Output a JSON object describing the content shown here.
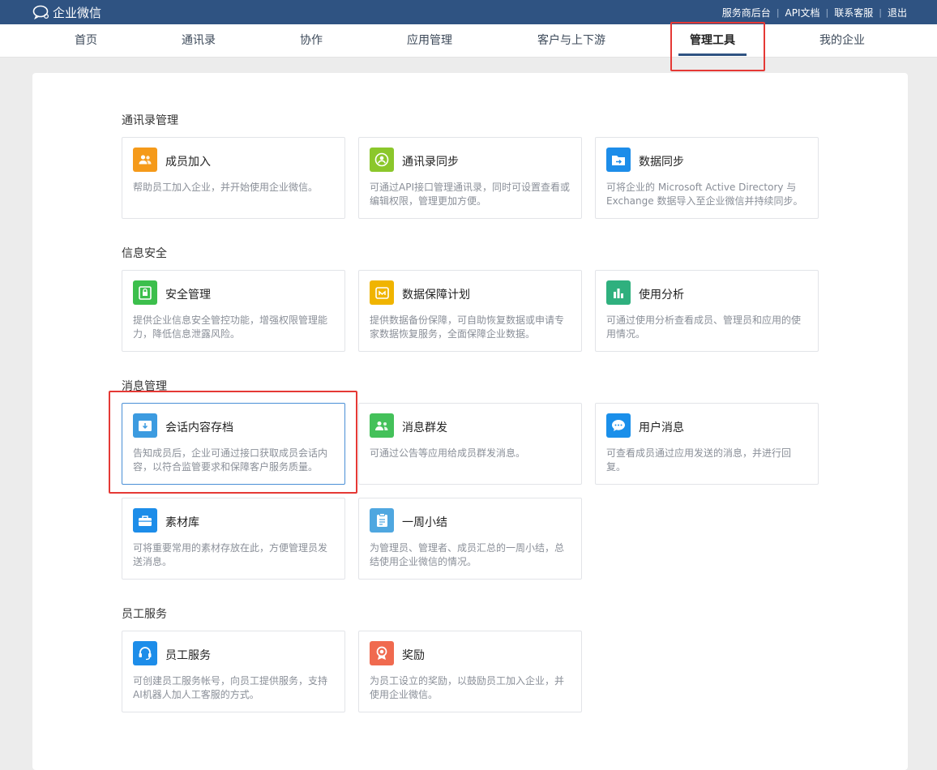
{
  "brand": {
    "name": "企业微信"
  },
  "toplinks": [
    "服务商后台",
    "API文档",
    "联系客服",
    "退出"
  ],
  "nav": {
    "items": [
      "首页",
      "通讯录",
      "协作",
      "应用管理",
      "客户与上下游",
      "管理工具",
      "我的企业"
    ],
    "active": "管理工具"
  },
  "sections": [
    {
      "title": "通讯录管理"
    },
    {
      "title": "信息安全"
    },
    {
      "title": "消息管理"
    },
    {
      "title": "员工服务"
    }
  ],
  "cards": [
    {
      "title": "成员加入",
      "desc": "帮助员工加入企业，并开始使用企业微信。",
      "icon": "user-group-icon",
      "color": "#f59a1a"
    },
    {
      "title": "通讯录同步",
      "desc": "可通过API接口管理通讯录，同时可设置查看或编辑权限，管理更加方便。",
      "icon": "person-circle-icon",
      "color": "#8bc72b"
    },
    {
      "title": "数据同步",
      "desc": "可将企业的 Microsoft Active Directory 与 Exchange 数据导入至企业微信并持续同步。",
      "icon": "folder-sync-icon",
      "color": "#1d8de9"
    },
    {
      "title": "安全管理",
      "desc": "提供企业信息安全管控功能，增强权限管理能力，降低信息泄露风险。",
      "icon": "shield-lock-icon",
      "color": "#3cbf4c"
    },
    {
      "title": "数据保障计划",
      "desc": "提供数据备份保障，可自助恢复数据或申请专家数据恢复服务，全面保障企业数据。",
      "icon": "database-shield-icon",
      "color": "#f0b400"
    },
    {
      "title": "使用分析",
      "desc": "可通过使用分析查看成员、管理员和应用的使用情况。",
      "icon": "bar-chart-icon",
      "color": "#2fb07e"
    },
    {
      "title": "会话内容存档",
      "desc": "告知成员后，企业可通过接口获取成员会话内容，以符合监管要求和保障客户服务质量。",
      "icon": "archive-download-icon",
      "color": "#3c9be0"
    },
    {
      "title": "消息群发",
      "desc": "可通过公告等应用给成员群发消息。",
      "icon": "broadcast-message-icon",
      "color": "#44c15a"
    },
    {
      "title": "用户消息",
      "desc": "可查看成员通过应用发送的消息，并进行回复。",
      "icon": "chat-bubble-icon",
      "color": "#1a8fea"
    },
    {
      "title": "素材库",
      "desc": "可将重要常用的素材存放在此，方便管理员发送消息。",
      "icon": "briefcase-icon",
      "color": "#1d8de9"
    },
    {
      "title": "一周小结",
      "desc": "为管理员、管理者、成员汇总的一周小结，总结使用企业微信的情况。",
      "icon": "clipboard-icon",
      "color": "#4fa7e0"
    },
    {
      "title": "员工服务",
      "desc": "可创建员工服务帐号，向员工提供服务，支持AI机器人加人工客服的方式。",
      "icon": "headset-icon",
      "color": "#1d8de9"
    },
    {
      "title": "奖励",
      "desc": "为员工设立的奖励，以鼓励员工加入企业，并使用企业微信。",
      "icon": "award-medal-icon",
      "color": "#f06a4f"
    }
  ]
}
